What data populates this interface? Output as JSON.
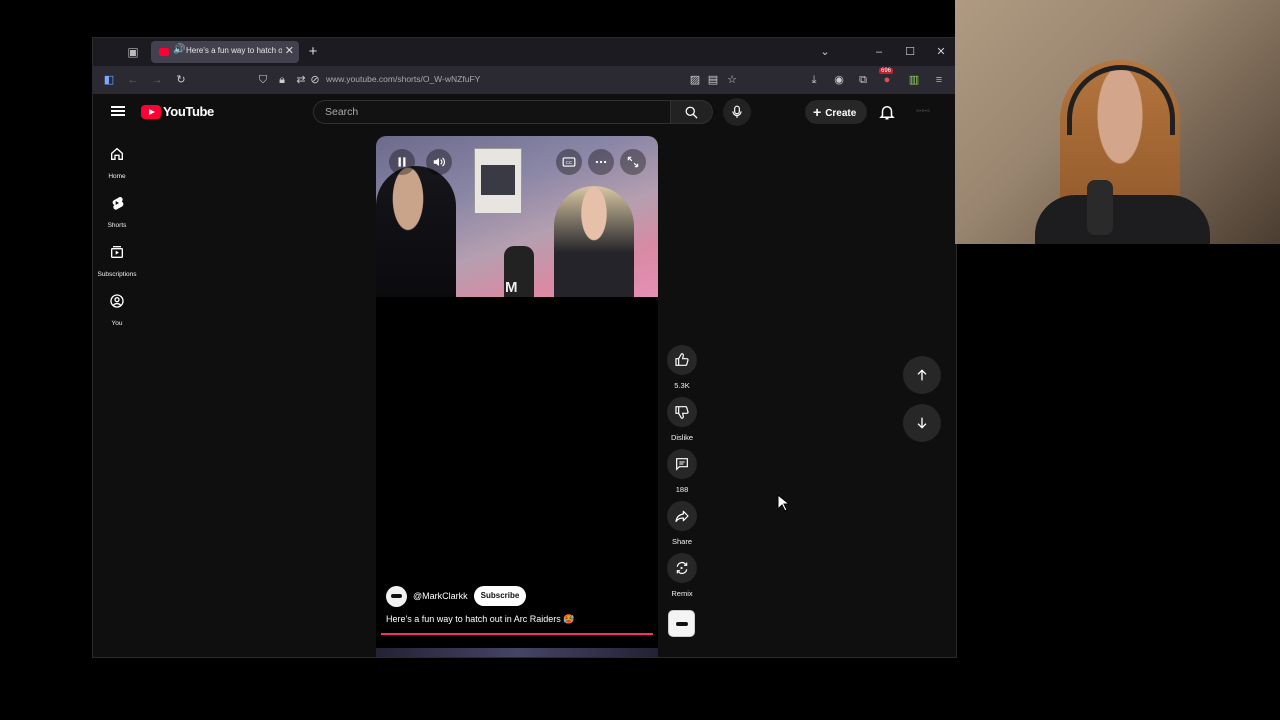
{
  "browser": {
    "tab_title": "Here's a fun way to hatch o",
    "url": "www.youtube.com/shorts/O_W-wNZfuFY",
    "extension_badge": "696"
  },
  "youtube": {
    "logo_text": "YouTube",
    "search_placeholder": "Search",
    "create_label": "Create",
    "sidebar": [
      {
        "label": "Home",
        "icon": "home-icon"
      },
      {
        "label": "Shorts",
        "icon": "shorts-icon"
      },
      {
        "label": "Subscriptions",
        "icon": "subscriptions-icon"
      },
      {
        "label": "You",
        "icon": "you-icon"
      }
    ],
    "short": {
      "watermark": "M",
      "channel": "@MarkClarkk",
      "subscribe_label": "Subscribe",
      "caption": "Here's a fun way to hatch out in Arc Raiders 🥵",
      "progress": 1.0
    },
    "actions": {
      "likes": "5.3K",
      "dislike_label": "Dislike",
      "comments": "188",
      "share_label": "Share",
      "remix_label": "Remix"
    }
  },
  "colors": {
    "accent": "#ff0033",
    "progress": "#ff2a6b",
    "background": "#0f0f0f"
  }
}
